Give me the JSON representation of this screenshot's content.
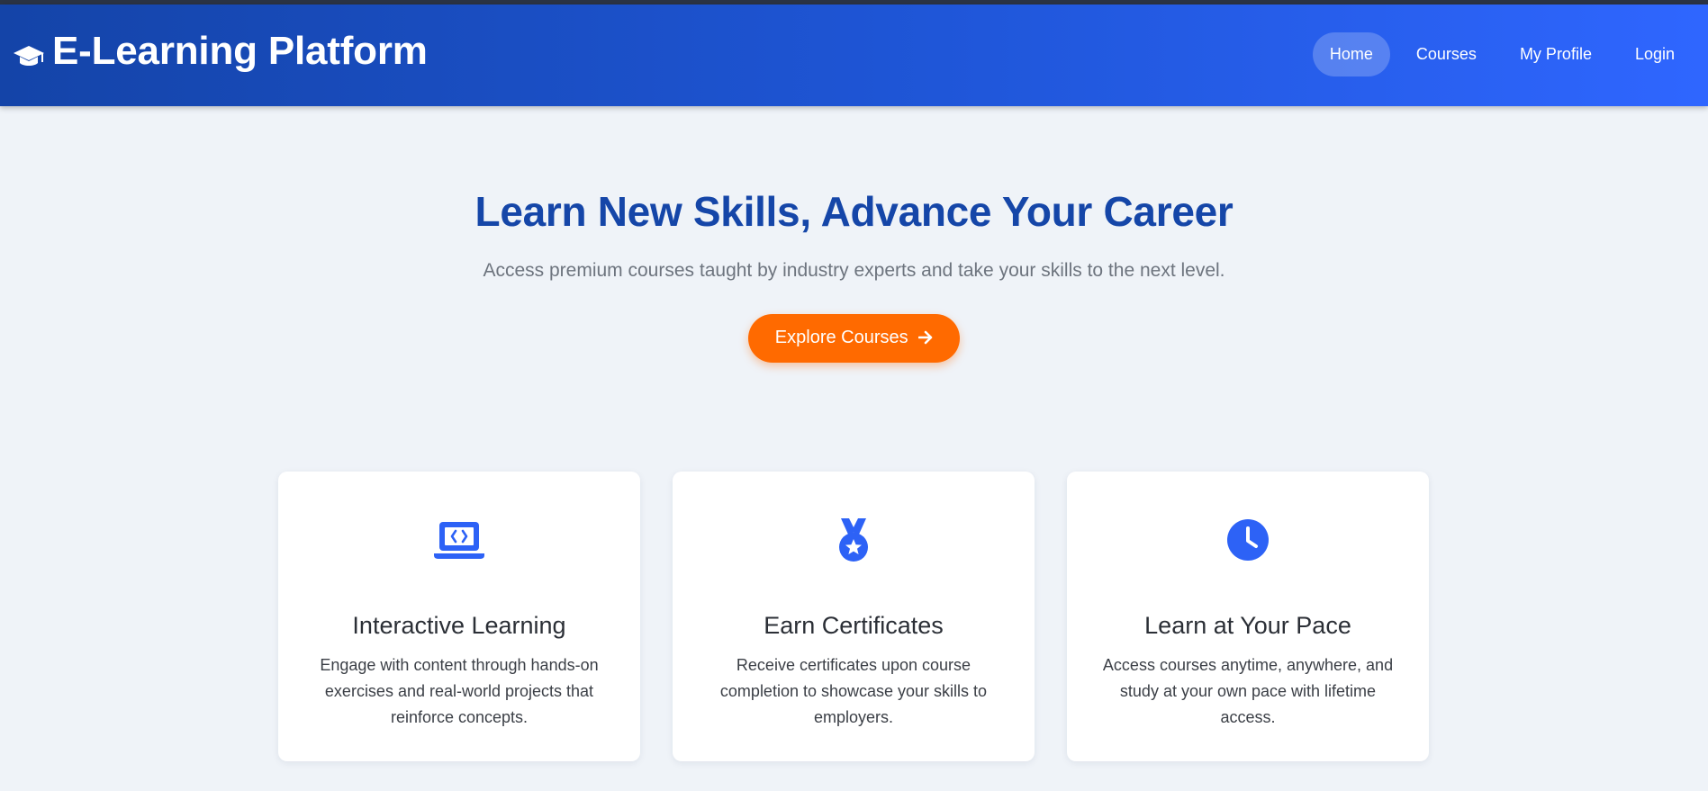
{
  "header": {
    "brand_title": "E-Learning Platform",
    "nav": [
      {
        "label": "Home",
        "active": true
      },
      {
        "label": "Courses",
        "active": false
      },
      {
        "label": "My Profile",
        "active": false
      },
      {
        "label": "Login",
        "active": false
      }
    ]
  },
  "hero": {
    "title": "Learn New Skills, Advance Your Career",
    "subtitle": "Access premium courses taught by industry experts and take your skills to the next level.",
    "cta_label": "Explore Courses",
    "cta_icon": "arrow-right-icon"
  },
  "features": [
    {
      "icon": "laptop-code-icon",
      "title": "Interactive Learning",
      "description": "Engage with content through hands-on exercises and real-world projects that reinforce concepts."
    },
    {
      "icon": "medal-icon",
      "title": "Earn Certificates",
      "description": "Receive certificates upon course completion to showcase your skills to employers."
    },
    {
      "icon": "clock-icon",
      "title": "Learn at Your Pace",
      "description": "Access courses anytime, anywhere, and study at your own pace with lifetime access."
    }
  ],
  "colors": {
    "header_start": "#1444a8",
    "header_end": "#2f66ff",
    "accent_blue": "#2d62f6",
    "title_blue": "#1546a8",
    "cta_orange": "#ff6a00",
    "page_bg": "#eff3f8"
  }
}
